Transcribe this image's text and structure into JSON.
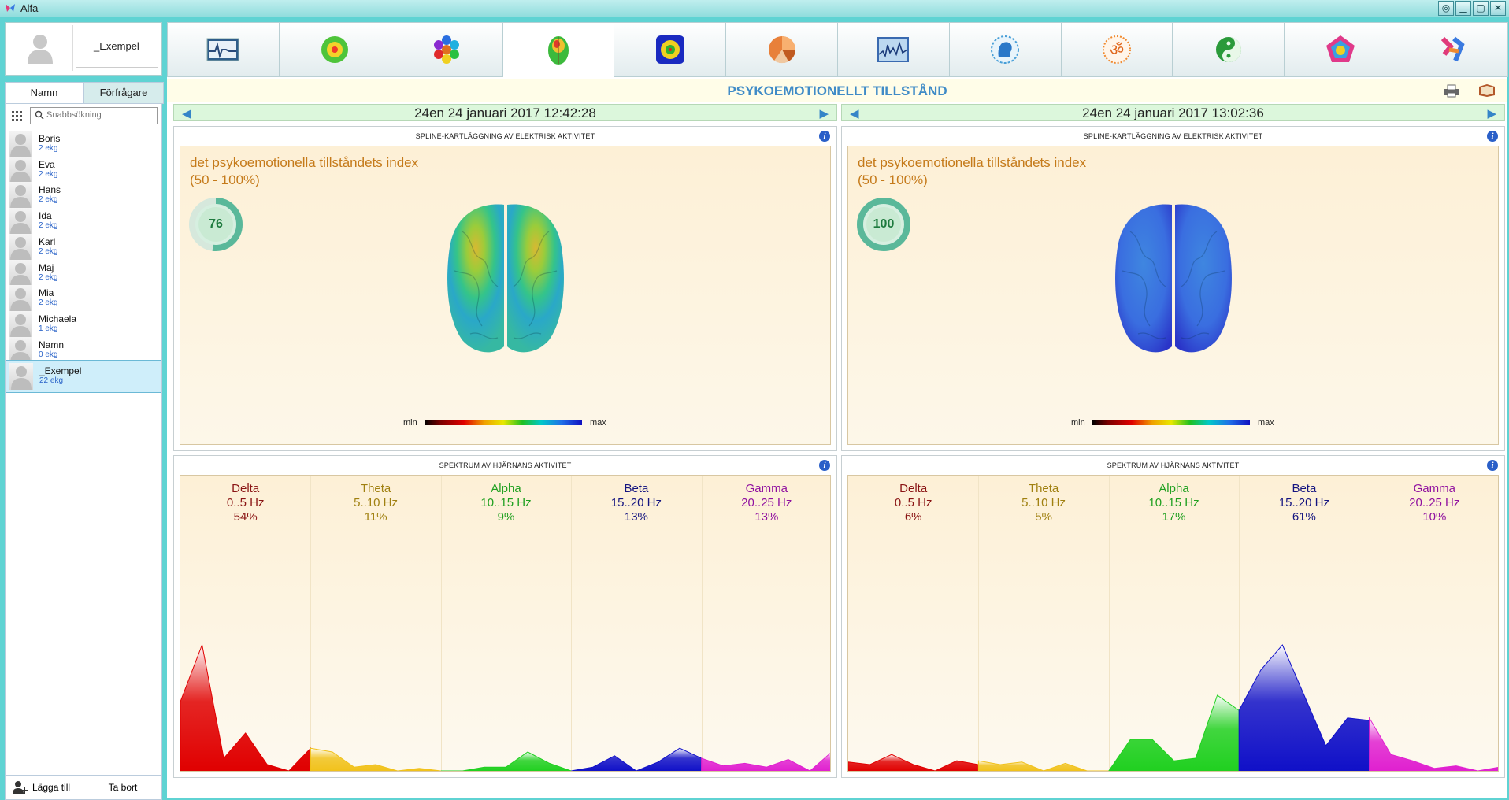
{
  "app": {
    "title": "Alfa"
  },
  "window_buttons": [
    "settings-icon",
    "minimize-icon",
    "maximize-icon",
    "close-icon"
  ],
  "profile": {
    "name": "_Exempel"
  },
  "tabs": [
    {
      "label": "Namn",
      "active": true
    },
    {
      "label": "Förfrågare",
      "active": false
    }
  ],
  "search": {
    "placeholder": "Snabbsökning",
    "value": ""
  },
  "people": [
    {
      "name": "Boris",
      "ekg": "2 ekg"
    },
    {
      "name": "Eva",
      "ekg": "2 ekg"
    },
    {
      "name": "Hans",
      "ekg": "2 ekg"
    },
    {
      "name": "Ida",
      "ekg": "2 ekg"
    },
    {
      "name": "Karl",
      "ekg": "2 ekg"
    },
    {
      "name": "Maj",
      "ekg": "2 ekg"
    },
    {
      "name": "Mia",
      "ekg": "2 ekg"
    },
    {
      "name": "Michaela",
      "ekg": "1 ekg"
    },
    {
      "name": "Namn",
      "ekg": "0 ekg"
    },
    {
      "name": "_Exempel",
      "ekg": "22 ekg",
      "selected": true
    }
  ],
  "bottom": {
    "add_label": "Lägga till",
    "delete_label": "Ta bort"
  },
  "toolbar_icons": [
    "ecg-icon",
    "aura-icon",
    "chakra-hexagon-icon",
    "brain-map-icon",
    "energy-field-icon",
    "pie-chart-icon",
    "hrv-graph-icon",
    "head-profile-icon",
    "om-icon",
    "yin-yang-icon",
    "pentagon-icon",
    "biorhythm-icon"
  ],
  "active_toolbar": 3,
  "page": {
    "title": "PSYKOEMOTIONELLT TILLSTÅND"
  },
  "panels": [
    {
      "date": "24en 24 januari 2017 12:42:28",
      "map_title": "SPLINE-KARTLÄGGNING AV ELEKTRISK AKTIVITET",
      "index_title_1": "det psykoemotionella tillståndets index",
      "index_title_2": "(50 - 100%)",
      "index_value": "76",
      "legend_min": "min",
      "legend_max": "max",
      "spectrum_title": "SPEKTRUM AV HJÄRNANS AKTIVITET",
      "bands": [
        {
          "name": "Delta",
          "range": "0..5 Hz",
          "percent": "54%"
        },
        {
          "name": "Theta",
          "range": "5..10 Hz",
          "percent": "11%"
        },
        {
          "name": "Alpha",
          "range": "10..15 Hz",
          "percent": "9%"
        },
        {
          "name": "Beta",
          "range": "15..20 Hz",
          "percent": "13%"
        },
        {
          "name": "Gamma",
          "range": "20..25 Hz",
          "percent": "13%"
        }
      ],
      "spectrum": [
        [
          0.55,
          1.0,
          0.1,
          0.3,
          0.05,
          0.0,
          0.18
        ],
        [
          0.18,
          0.15,
          0.03,
          0.05,
          0.0,
          0.02,
          0.0
        ],
        [
          0.0,
          0.0,
          0.03,
          0.03,
          0.15,
          0.06,
          0.0
        ],
        [
          0.0,
          0.03,
          0.12,
          0.0,
          0.07,
          0.18,
          0.1
        ],
        [
          0.1,
          0.04,
          0.06,
          0.03,
          0.09,
          0.0,
          0.15
        ]
      ]
    },
    {
      "date": "24en 24 januari 2017 13:02:36",
      "map_title": "SPLINE-KARTLÄGGNING AV ELEKTRISK AKTIVITET",
      "index_title_1": "det psykoemotionella tillståndets index",
      "index_title_2": "(50 - 100%)",
      "index_value": "100",
      "legend_min": "min",
      "legend_max": "max",
      "spectrum_title": "SPEKTRUM AV HJÄRNANS AKTIVITET",
      "bands": [
        {
          "name": "Delta",
          "range": "0..5 Hz",
          "percent": "6%"
        },
        {
          "name": "Theta",
          "range": "5..10 Hz",
          "percent": "5%"
        },
        {
          "name": "Alpha",
          "range": "10..15 Hz",
          "percent": "17%"
        },
        {
          "name": "Beta",
          "range": "15..20 Hz",
          "percent": "61%"
        },
        {
          "name": "Gamma",
          "range": "20..25 Hz",
          "percent": "10%"
        }
      ],
      "spectrum": [
        [
          0.07,
          0.05,
          0.13,
          0.05,
          0.0,
          0.08,
          0.05
        ],
        [
          0.08,
          0.05,
          0.07,
          0.0,
          0.06,
          0.0,
          0.0
        ],
        [
          0.0,
          0.25,
          0.25,
          0.08,
          0.1,
          0.6,
          0.48
        ],
        [
          0.48,
          0.8,
          1.0,
          0.6,
          0.2,
          0.42,
          0.4
        ],
        [
          0.42,
          0.13,
          0.08,
          0.02,
          0.04,
          0.0,
          0.03
        ]
      ]
    }
  ],
  "band_colors": [
    "#e00000",
    "#f1c21b",
    "#20d020",
    "#1010c8",
    "#e020d0"
  ],
  "band_text_colors": [
    "#8a1414",
    "#a08010",
    "#20a020",
    "#141480",
    "#9010a0"
  ]
}
